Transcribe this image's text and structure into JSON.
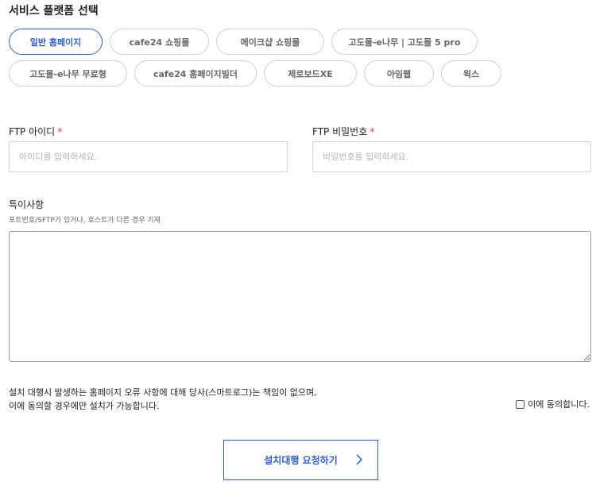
{
  "section": {
    "title": "서비스 플랫폼 선택"
  },
  "platforms": [
    {
      "label": "일반 홈페이지",
      "selected": true
    },
    {
      "label": "cafe24 쇼핑몰",
      "selected": false
    },
    {
      "label": "메이크샵 쇼핑몰",
      "selected": false
    },
    {
      "label": "고도몰-e나무 | 고도몰 5 pro",
      "selected": false
    },
    {
      "label": "고도몰-e나무 무료형",
      "selected": false
    },
    {
      "label": "cafe24 홈페이지빌더",
      "selected": false
    },
    {
      "label": "제로보드XE",
      "selected": false
    },
    {
      "label": "아임웹",
      "selected": false
    },
    {
      "label": "윅스",
      "selected": false
    }
  ],
  "ftp_id": {
    "label": "FTP 아이디",
    "required_mark": "*",
    "placeholder": "아이디를 입력하세요.",
    "value": ""
  },
  "ftp_pw": {
    "label": "FTP 비밀번호",
    "required_mark": "*",
    "placeholder": "비밀번호를 입력하세요.",
    "value": ""
  },
  "notes": {
    "label": "특이사항",
    "help": "포트번호/SFTP가 있거나, 호스트가 다른 경우 기재",
    "value": ""
  },
  "disclaimer": {
    "line1": "설치 대행시 발생하는 홈페이지 오류 사항에 대해 당사(스마트로그)는 책임이 없으며,",
    "line2": "이에 동의할 경우에만 설치가 가능합니다."
  },
  "agree": {
    "label": "이에 동의합니다.",
    "checked": false
  },
  "submit": {
    "label": "설치대행 요청하기",
    "icon": "chevron-right-icon"
  },
  "colors": {
    "accent": "#2f5fd0",
    "required": "#e03131",
    "border": "#cfcfcf"
  }
}
